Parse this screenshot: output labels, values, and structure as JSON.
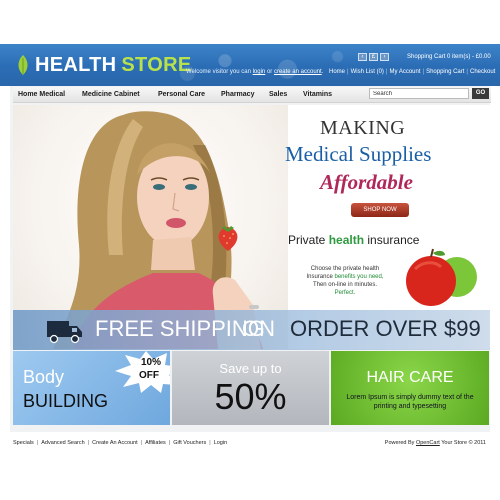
{
  "brand": {
    "word1": "HEALTH",
    "word2": "STORE"
  },
  "header": {
    "cart_summary": "Shopping Cart 0 item(s) - £0.00",
    "welcome_prefix": "Welcome visitor you can",
    "login": "login",
    "or": "or",
    "create_account": "create an account",
    "welcome_suffix": ".",
    "links": [
      "Home",
      "Wish List (0)",
      "My Account",
      "Shopping Cart",
      "Checkout"
    ],
    "flags": [
      "‹",
      "£",
      "›"
    ]
  },
  "nav": {
    "items": [
      "Home Medical",
      "Medicine Cabinet",
      "Personal Care",
      "Pharmacy",
      "Sales",
      "Vitamins"
    ],
    "search_value": "Search",
    "go_label": "GO"
  },
  "banner": {
    "line1": "MAKING",
    "line2": "Medical Supplies",
    "line3": "Affordable",
    "shop_now": "SHOP NOW",
    "private_pre": "Private",
    "private_hl": "health",
    "private_post": "insurance",
    "desc1": "Choose the private health",
    "desc2_pre": "Insurance",
    "desc2_hl": "benefits you need,",
    "desc3": "Then on-line in minutes.",
    "desc4": "Perfect."
  },
  "shipping": {
    "part1": "FREE SHIPPING",
    "part2": "ON",
    "part3": "ORDER OVER $99"
  },
  "promos": {
    "body_line1": "Body",
    "body_line2": "BUILDING",
    "off_pct": "10%",
    "off_word": "OFF",
    "save_line1": "Save up to",
    "save_line2": "50%",
    "hair_title": "HAIR CARE",
    "hair_text": "Lorem Ipsum is simply dummy text of the printing and typesetting"
  },
  "footer": {
    "links": [
      "Specials",
      "Advanced Search",
      "Create An Account",
      "Affiliates",
      "Gift Vouchers",
      "Login"
    ],
    "powered_pre": "Powered By",
    "powered_link": "OpenCart",
    "powered_post": "Your Store © 2011"
  },
  "colors": {
    "header_blue": "#2b6db5",
    "brand_green": "#b9e24a",
    "heading_blue": "#1a5fa6",
    "affordable_pink": "#b0275a",
    "promo_green": "#5aa920"
  },
  "icons": [
    "leaf-icon",
    "truck-icon",
    "starburst-badge",
    "apple-icon",
    "strawberry-icon"
  ]
}
